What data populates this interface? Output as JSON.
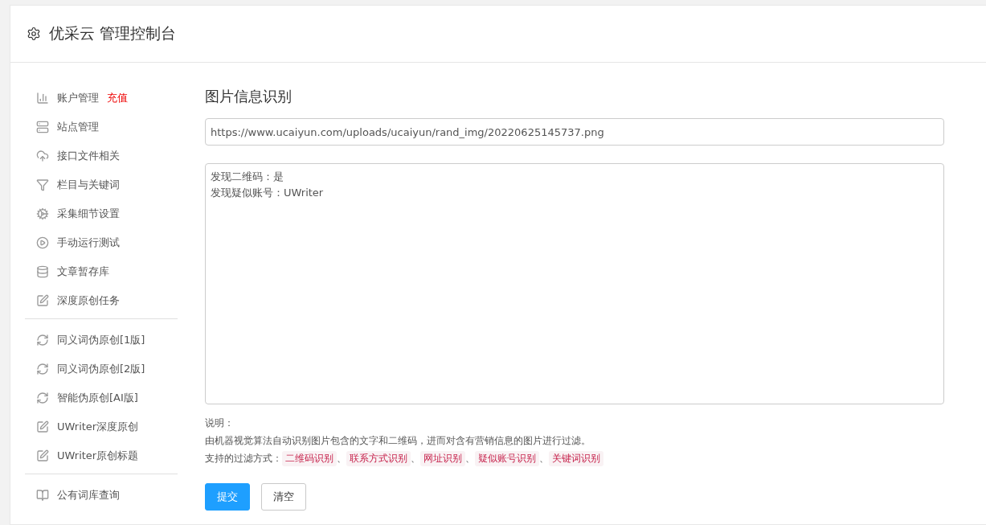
{
  "header": {
    "title": "优采云 管理控制台"
  },
  "sidebar": {
    "groups": [
      {
        "items": [
          {
            "label": "账户管理",
            "tag": "充值"
          },
          {
            "label": "站点管理"
          },
          {
            "label": "接口文件相关"
          },
          {
            "label": "栏目与关键词"
          },
          {
            "label": "采集细节设置"
          },
          {
            "label": "手动运行测试"
          },
          {
            "label": "文章暂存库"
          },
          {
            "label": "深度原创任务"
          }
        ]
      },
      {
        "items": [
          {
            "label": "同义词伪原创[1版]"
          },
          {
            "label": "同义词伪原创[2版]"
          },
          {
            "label": "智能伪原创[AI版]"
          },
          {
            "label": "UWriter深度原创"
          },
          {
            "label": "UWriter原创标题"
          }
        ]
      },
      {
        "items": [
          {
            "label": "公有词库查询"
          }
        ]
      }
    ]
  },
  "main": {
    "title": "图片信息识别",
    "url_field": {
      "value": "https://www.ucaiyun.com/uploads/ucaiyun/rand_img/20220625145737.png"
    },
    "result_field": {
      "lines": [
        "发现二维码：是",
        "发现疑似账号：UWriter"
      ]
    },
    "notes": {
      "heading": "说明：",
      "description": "由机器视觉算法自动识别图片包含的文字和二维码，进而对含有营销信息的图片进行过滤。",
      "methods_label": "支持的过滤方式：",
      "separator": "、",
      "methods": [
        "二维码识别",
        "联系方式识别",
        "网址识别",
        "疑似账号识别",
        "关键词识别"
      ]
    },
    "buttons": [
      {
        "label": "提交",
        "kind": "primary"
      },
      {
        "label": "清空",
        "kind": "default"
      }
    ]
  }
}
